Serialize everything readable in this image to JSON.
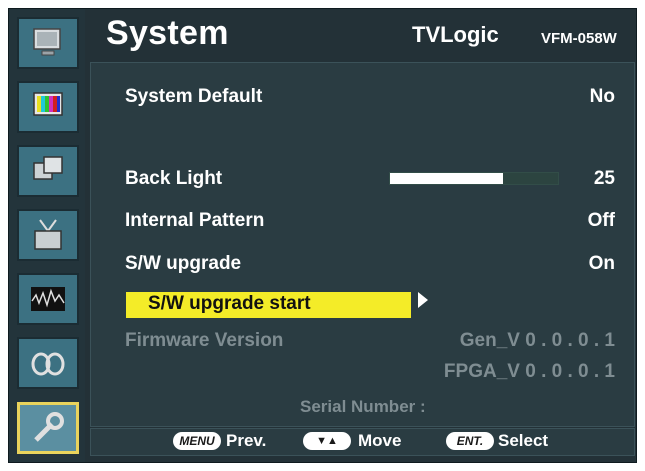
{
  "header": {
    "title": "System",
    "brand": "TVLogic",
    "model": "VFM-058W"
  },
  "sidebar": {
    "items": [
      {
        "icon": "monitor-icon",
        "active": false
      },
      {
        "icon": "color-bars-icon",
        "active": false
      },
      {
        "icon": "windows-icon",
        "active": false
      },
      {
        "icon": "tv-antenna-icon",
        "active": false
      },
      {
        "icon": "waveform-icon",
        "active": false
      },
      {
        "icon": "audio-icon",
        "active": false
      },
      {
        "icon": "system-tools-icon",
        "active": true
      }
    ]
  },
  "menu": {
    "system_default": {
      "label": "System Default",
      "value": "No"
    },
    "back_light": {
      "label": "Back Light",
      "value": "25",
      "level": 0.67
    },
    "internal_pattern": {
      "label": "Internal Pattern",
      "value": "Off"
    },
    "sw_upgrade": {
      "label": "S/W upgrade",
      "value": "On"
    },
    "sw_upgrade_start": {
      "label": "S/W upgrade start"
    },
    "firmware_version": {
      "label": "Firmware Version",
      "gen": "Gen_V 0 . 0 . 0 . 1",
      "fpga": "FPGA_V 0 . 0 . 0 . 1"
    },
    "serial_number": {
      "label": "Serial Number :"
    }
  },
  "footer": {
    "menu_key": "MENU",
    "prev": "Prev.",
    "move_key": "▼▲",
    "move": "Move",
    "ent_key": "ENT.",
    "select": "Select"
  },
  "colors": {
    "highlight": "#f4ec28",
    "accent_border": "#e9d35c",
    "panel": "#2a3c42"
  }
}
